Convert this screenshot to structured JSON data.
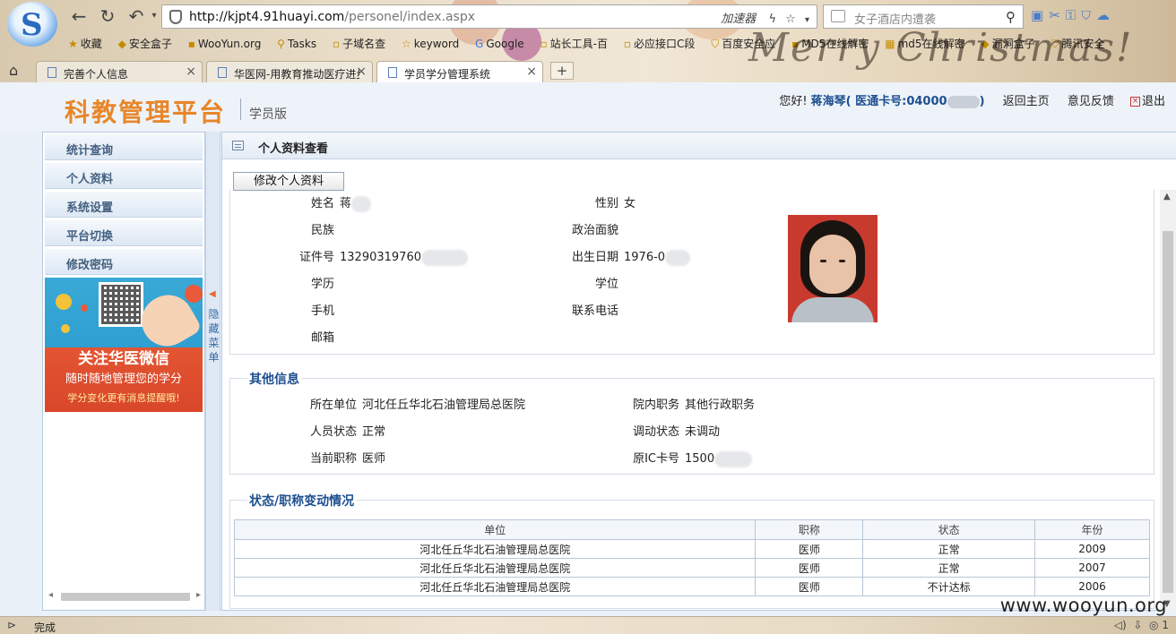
{
  "browser": {
    "url_host": "http://kjpt4.91huayi.com",
    "url_path": "/personel/index.aspx",
    "accelerator_label": "加速器",
    "search_placeholder": "女子酒店内遭袭",
    "bookmarks": [
      {
        "label": "收藏",
        "icon": "star-icon"
      },
      {
        "label": "安全盒子",
        "icon": "box-icon"
      },
      {
        "label": "WooYun.org",
        "icon": "site-icon"
      },
      {
        "label": "Tasks",
        "icon": "tasks-icon"
      },
      {
        "label": "子域名查",
        "icon": "site-icon"
      },
      {
        "label": "keyword",
        "icon": "site-icon"
      },
      {
        "label": "Google",
        "icon": "google-icon"
      },
      {
        "label": "站长工具-百",
        "icon": "site-icon"
      },
      {
        "label": "必应接口C段",
        "icon": "site-icon"
      },
      {
        "label": "百度安全应",
        "icon": "site-icon"
      },
      {
        "label": "MD5在线解密",
        "icon": "site-icon"
      },
      {
        "label": "md5在线解密",
        "icon": "site-icon"
      },
      {
        "label": "漏洞盒子",
        "icon": "site-icon"
      },
      {
        "label": "腾讯安全",
        "icon": "site-icon"
      }
    ],
    "decoration_text": "Merry Christmas!",
    "tabs": [
      {
        "label": "完善个人信息",
        "close": "×"
      },
      {
        "label": "华医网-用教育推动医疗进步",
        "close": "×"
      },
      {
        "label": "学员学分管理系统",
        "close": "×"
      }
    ],
    "new_tab": "+",
    "status_text": "完成",
    "status_right": "1"
  },
  "header": {
    "logo": "科教管理平台",
    "subtitle": "学员版",
    "greeting": "您好!",
    "user_name": "蒋海琴( 医通卡号:04000",
    "user_close": ")",
    "home_link": "返回主页",
    "feedback_link": "意见反馈",
    "logout_link": "退出"
  },
  "sidebar": {
    "items": [
      "统计查询",
      "个人资料",
      "系统设置",
      "平台切换",
      "修改密码"
    ],
    "banner_title": "关注华医微信",
    "banner_line2": "随时随地管理您的学分",
    "banner_line3": "学分变化更有消息提醒哦!",
    "toggle_label": "隐藏菜单"
  },
  "main": {
    "title": "个人资料查看",
    "edit_button": "修改个人资料",
    "profile": {
      "name_label": "姓名",
      "name_value": "蒋",
      "gender_label": "性别",
      "gender_value": "女",
      "ethnicity_label": "民族",
      "ethnicity_value": "",
      "politics_label": "政治面貌",
      "politics_value": "",
      "id_label": "证件号",
      "id_value": "13290319760",
      "birth_label": "出生日期",
      "birth_value": "1976-0",
      "education_label": "学历",
      "education_value": "",
      "degree_label": "学位",
      "degree_value": "",
      "mobile_label": "手机",
      "mobile_value": "",
      "phone_label": "联系电话",
      "phone_value": "",
      "email_label": "邮箱",
      "email_value": ""
    },
    "other": {
      "heading": "其他信息",
      "unit_label": "所在单位",
      "unit_value": "河北任丘华北石油管理局总医院",
      "position_label": "院内职务",
      "position_value": "其他行政职务",
      "staff_status_label": "人员状态",
      "staff_status_value": "正常",
      "transfer_label": "调动状态",
      "transfer_value": "未调动",
      "title_label": "当前职称",
      "title_value": "医师",
      "ic_label": "原IC卡号",
      "ic_value": "1500"
    },
    "history": {
      "heading": "状态/职称变动情况",
      "columns": [
        "单位",
        "职称",
        "状态",
        "年份"
      ],
      "rows": [
        [
          "河北任丘华北石油管理局总医院",
          "医师",
          "正常",
          "2009"
        ],
        [
          "河北任丘华北石油管理局总医院",
          "医师",
          "正常",
          "2007"
        ],
        [
          "河北任丘华北石油管理局总医院",
          "医师",
          "不计达标",
          "2006"
        ]
      ]
    }
  },
  "watermark": "www.wooyun.org",
  "colors": {
    "brand_orange": "#e8862a",
    "link_blue": "#1d4f8f",
    "panel_bg": "#eaf1f9"
  }
}
